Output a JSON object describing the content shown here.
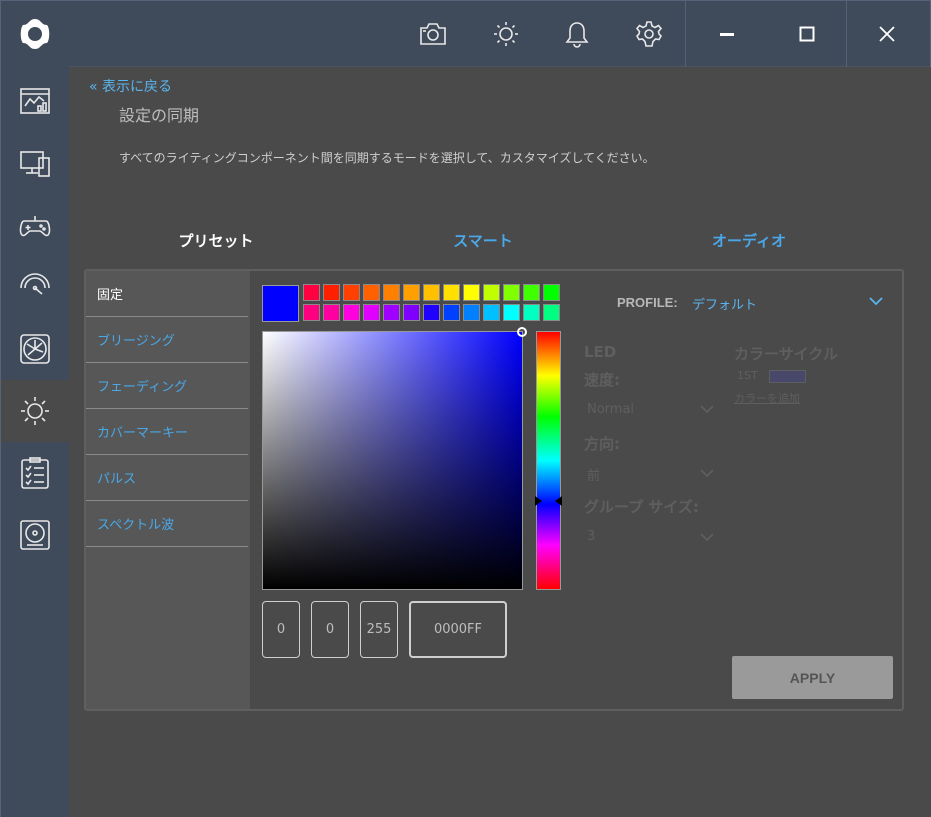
{
  "titlebar": {
    "icons": [
      "camera-icon",
      "brightness-icon",
      "bell-icon",
      "gear-icon"
    ],
    "window_buttons": [
      "minimize-icon",
      "maximize-icon",
      "close-icon"
    ]
  },
  "sidebar": {
    "items": [
      {
        "icon": "dashboard-icon"
      },
      {
        "icon": "monitor-icon"
      },
      {
        "icon": "gamepad-icon"
      },
      {
        "icon": "speedometer-icon"
      },
      {
        "icon": "fan-icon"
      },
      {
        "icon": "lighting-icon",
        "active": true
      },
      {
        "icon": "checklist-icon"
      },
      {
        "icon": "disk-icon"
      }
    ]
  },
  "main": {
    "back_link": "表示に戻る",
    "title": "設定の同期",
    "description": "すべてのライティングコンポーネント間を同期するモードを選択して、カスタマイズしてください。",
    "mode_tabs": [
      {
        "label": "プリセット",
        "active": true
      },
      {
        "label": "スマート",
        "active": false
      },
      {
        "label": "オーディオ",
        "active": false
      }
    ]
  },
  "effects": [
    {
      "label": "固定",
      "active": true
    },
    {
      "label": "ブリージング",
      "active": false
    },
    {
      "label": "フェーディング",
      "active": false
    },
    {
      "label": "カバーマーキー",
      "active": false
    },
    {
      "label": "パルス",
      "active": false
    },
    {
      "label": "スペクトル波",
      "active": false
    }
  ],
  "color": {
    "selected": "#0000FF",
    "r": "0",
    "g": "0",
    "b": "255",
    "hex": "0000FF",
    "presets_row1": [
      "#ff0040",
      "#ff2000",
      "#ff4000",
      "#ff6000",
      "#ff8000",
      "#ffa000",
      "#ffc000",
      "#ffe000",
      "#ffff00",
      "#c0ff00",
      "#80ff00",
      "#40ff00",
      "#00ff00"
    ],
    "presets_row2": [
      "#ff0080",
      "#ff00a0",
      "#ff00e0",
      "#e000ff",
      "#a000ff",
      "#8000ff",
      "#2000ff",
      "#0040ff",
      "#0080ff",
      "#00c0ff",
      "#00ffff",
      "#00ffc0",
      "#00ff80"
    ]
  },
  "settings": {
    "profile_label": "PROFILE:",
    "profile_value": "デフォルト",
    "led_label": "LED",
    "speed_label": "速度:",
    "speed_value": "Normal",
    "direction_label": "方向:",
    "direction_value": "前",
    "group_size_label": "グループ サイズ:",
    "group_size_value": "3",
    "color_cycle_label": "カラーサイクル",
    "first_label": "1ST",
    "add_label": "カラーを追加",
    "apply_label": "APPLY"
  }
}
